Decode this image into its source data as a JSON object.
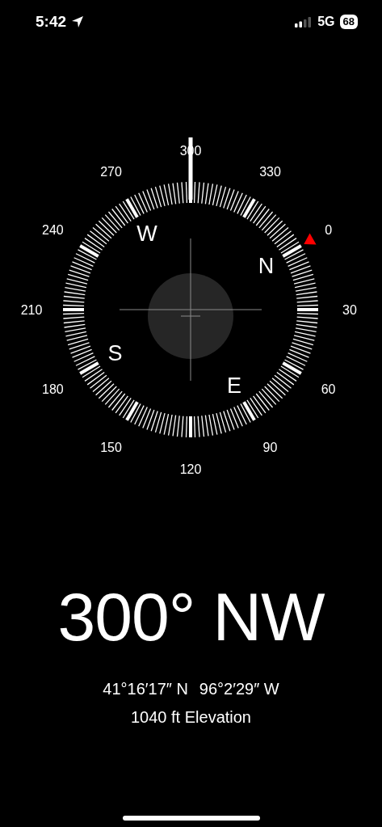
{
  "status_bar": {
    "time": "5:42",
    "network": "5G",
    "battery": "68"
  },
  "compass": {
    "dial_labels": [
      {
        "label": "300",
        "north": false
      },
      {
        "label": "330",
        "north": false
      },
      {
        "label": "0",
        "north": true
      },
      {
        "label": "30",
        "north": false
      },
      {
        "label": "60",
        "north": false
      },
      {
        "label": "90",
        "north": false
      },
      {
        "label": "120",
        "north": false
      },
      {
        "label": "150",
        "north": false
      },
      {
        "label": "180",
        "north": false
      },
      {
        "label": "210",
        "north": false
      },
      {
        "label": "240",
        "north": false
      },
      {
        "label": "270",
        "north": false
      }
    ],
    "cardinals": [
      "N",
      "E",
      "S",
      "W"
    ]
  },
  "heading": "300° NW",
  "coordinates": [
    "41°16′17″ N",
    "96°2′29″ W"
  ],
  "elevation": "1040 ft Elevation"
}
